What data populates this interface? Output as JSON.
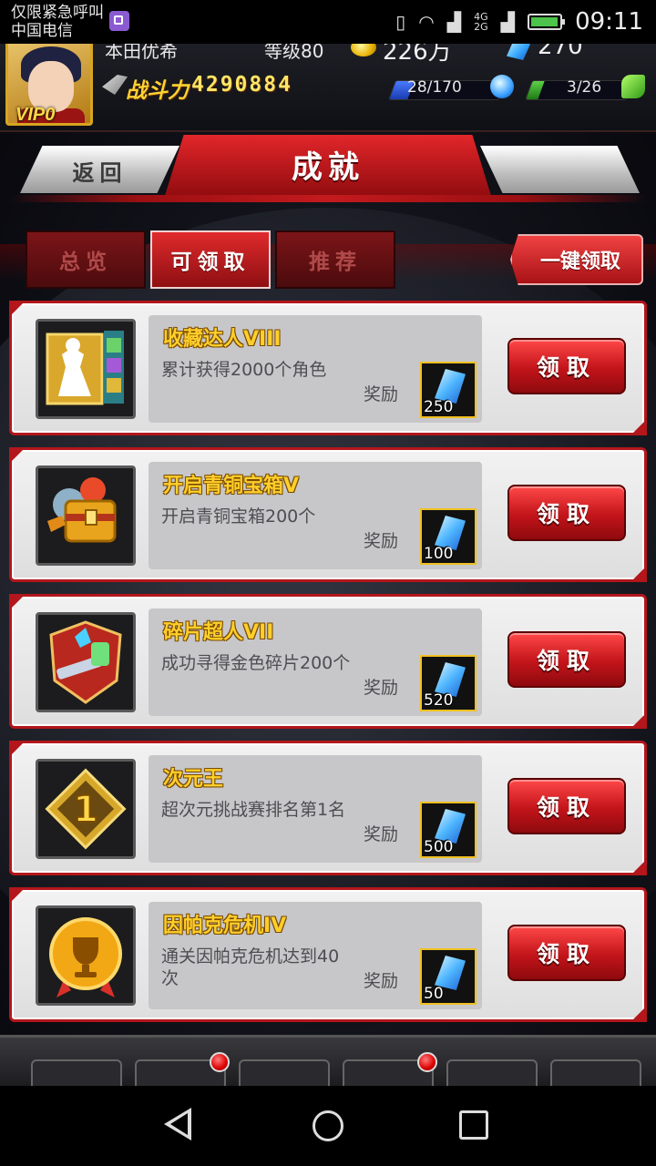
{
  "status_bar": {
    "line1": "仅限紧急呼叫",
    "line2": "中国电信",
    "network": "4G\n2G",
    "time": "09:11"
  },
  "player": {
    "name": "本田优希",
    "level": "等级80",
    "gold": "226万",
    "gems": "270",
    "vip": "VIP0",
    "power_label": "战斗力",
    "power_value": "4290884",
    "stamina": "28/170",
    "energy": "3/26"
  },
  "header": {
    "back_label": "返回",
    "title": "成就"
  },
  "tabs": [
    {
      "label": "总览",
      "active": false
    },
    {
      "label": "可领取",
      "active": true
    },
    {
      "label": "推荐",
      "active": false
    }
  ],
  "claim_all_label": "一键领取",
  "reward_label": "奖励",
  "claim_label": "领取",
  "achievements": [
    {
      "title": "收藏达人VIII",
      "desc": "累计获得2000个角色",
      "reward": "250",
      "icon": "collection-icon"
    },
    {
      "title": "开启青铜宝箱V",
      "desc": "开启青铜宝箱200个",
      "reward": "100",
      "icon": "treasure-chest-icon"
    },
    {
      "title": "碎片超人VII",
      "desc": "成功寻得金色碎片200个",
      "reward": "520",
      "icon": "fragment-badge-icon"
    },
    {
      "title": "次元王",
      "desc": "超次元挑战赛排名第1名",
      "reward": "500",
      "icon": "rank-one-icon"
    },
    {
      "title": "因帕克危机IV",
      "desc": "通关因帕克危机达到40次",
      "reward": "50",
      "icon": "trophy-icon"
    }
  ],
  "colors": {
    "accent_red": "#c2141a",
    "title_gold": "#ffcf2a",
    "card_bg": "#e8e8e8"
  }
}
